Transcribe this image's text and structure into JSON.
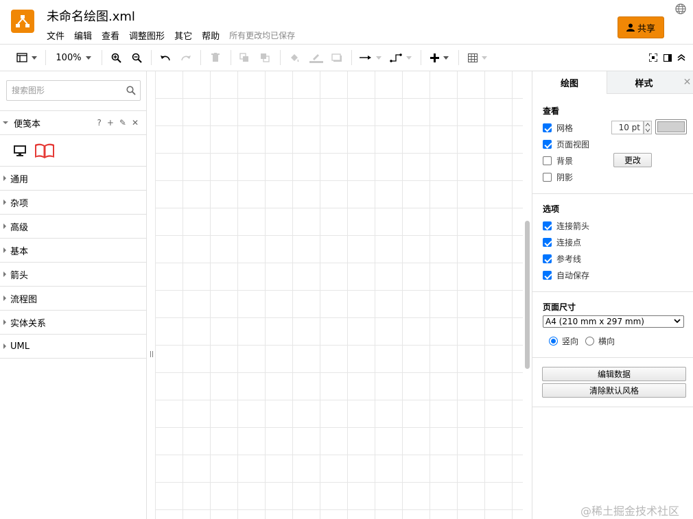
{
  "header": {
    "title": "未命名绘图.xml",
    "menus": [
      "文件",
      "编辑",
      "查看",
      "调整图形",
      "其它",
      "帮助"
    ],
    "save_status": "所有更改均已保存",
    "share_label": "共享",
    "accent_color": "#f08705"
  },
  "toolbar": {
    "zoom": "100%",
    "icons": [
      "format-panel-icon",
      "zoom-in-icon",
      "zoom-out-icon",
      "undo-icon",
      "redo-icon",
      "delete-icon",
      "to-front-icon",
      "to-back-icon",
      "fill-color-icon",
      "line-color-icon",
      "shadow-icon",
      "connection-icon",
      "waypoints-icon",
      "insert-icon",
      "table-icon",
      "fullscreen-icon",
      "toggle-format-icon",
      "collapse-icon"
    ]
  },
  "sidebar": {
    "search_placeholder": "搜索图形",
    "scratchpad": {
      "title": "便笺本",
      "actions": [
        "?",
        "+",
        "✎",
        "✕"
      ]
    },
    "palettes": [
      "通用",
      "杂项",
      "高级",
      "基本",
      "箭头",
      "流程图",
      "实体关系",
      "UML"
    ]
  },
  "format_panel": {
    "tabs": {
      "active": "绘图",
      "inactive": "样式"
    },
    "view": {
      "title": "查看",
      "grid_label": "网格",
      "grid_checked": true,
      "grid_size": "10 pt",
      "page_view_label": "页面视图",
      "page_view_checked": true,
      "background_label": "背景",
      "background_checked": false,
      "change_button": "更改",
      "shadow_label": "阴影",
      "shadow_checked": false
    },
    "options": {
      "title": "选项",
      "connection_arrows": "连接箭头",
      "connection_points": "连接点",
      "guides": "参考线",
      "autosave": "自动保存"
    },
    "page_size": {
      "title": "页面尺寸",
      "selected": "A4 (210 mm x 297 mm)",
      "portrait": "竖向",
      "landscape": "横向",
      "orientation": "portrait"
    },
    "buttons": {
      "edit_data": "编辑数据",
      "clear_default_style": "清除默认风格"
    }
  },
  "watermark": "@稀土掘金技术社区"
}
